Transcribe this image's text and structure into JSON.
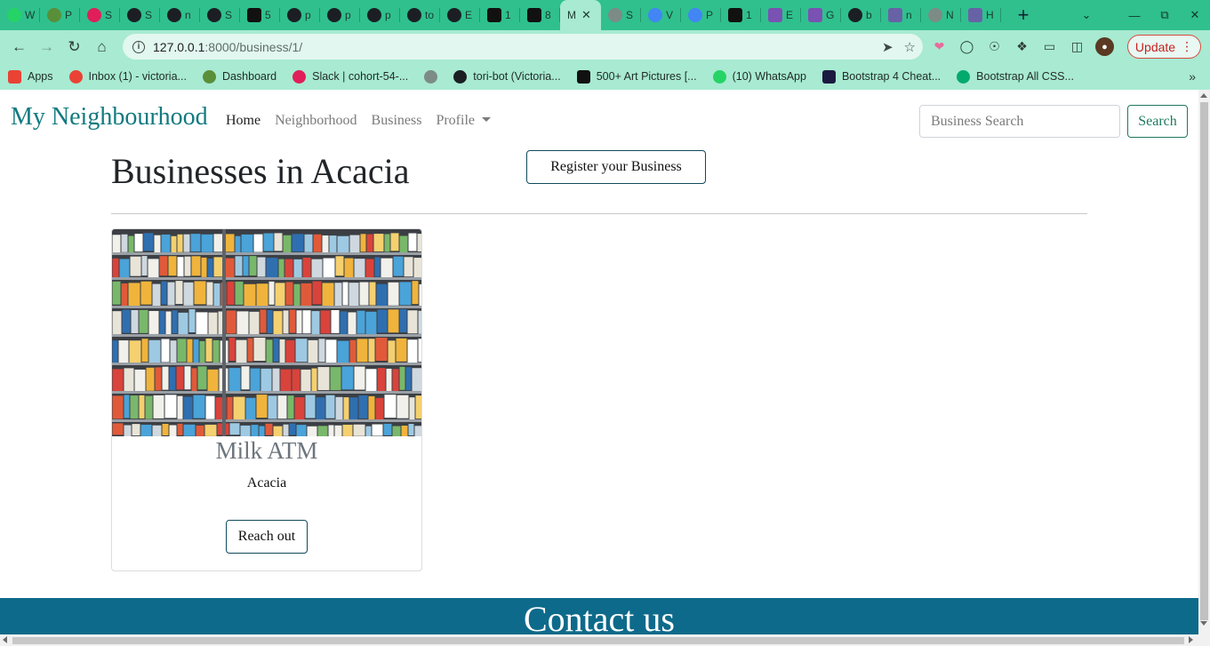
{
  "browser": {
    "tabs": [
      {
        "label": "W",
        "icon": "whatsapp-icon",
        "color": "#25d366"
      },
      {
        "label": "P",
        "icon": "palm-tree-icon",
        "color": "#5a8f3a"
      },
      {
        "label": "S",
        "icon": "slack-icon",
        "color": "#e01e5a"
      },
      {
        "label": "S",
        "icon": "github-icon",
        "color": "#1b1f23"
      },
      {
        "label": "n",
        "icon": "github-icon",
        "color": "#1b1f23"
      },
      {
        "label": "S",
        "icon": "github-icon",
        "color": "#1b1f23"
      },
      {
        "label": "5",
        "icon": "unsplash-icon",
        "color": "#111111"
      },
      {
        "label": "p",
        "icon": "github-icon",
        "color": "#1b1f23"
      },
      {
        "label": "p",
        "icon": "github-icon",
        "color": "#1b1f23"
      },
      {
        "label": "p",
        "icon": "github-icon",
        "color": "#1b1f23"
      },
      {
        "label": "to",
        "icon": "github-icon",
        "color": "#1b1f23"
      },
      {
        "label": "E",
        "icon": "github-icon",
        "color": "#1b1f23"
      },
      {
        "label": "1",
        "icon": "is-icon",
        "color": "#111111"
      },
      {
        "label": "8",
        "icon": "is-icon",
        "color": "#111111"
      },
      {
        "label": "M",
        "icon": "",
        "color": "",
        "active": true
      },
      {
        "label": "S",
        "icon": "globe-icon",
        "color": "#7d8b86"
      },
      {
        "label": "V",
        "icon": "google-icon",
        "color": "#4285f4"
      },
      {
        "label": "P",
        "icon": "google-icon",
        "color": "#4285f4"
      },
      {
        "label": "1",
        "icon": "unsplash-icon",
        "color": "#111111"
      },
      {
        "label": "E",
        "icon": "bootstrap-icon",
        "color": "#7952b3"
      },
      {
        "label": "G",
        "icon": "bootstrap-icon",
        "color": "#7952b3"
      },
      {
        "label": "b",
        "icon": "github-icon",
        "color": "#1b1f23"
      },
      {
        "label": "n",
        "icon": "heroku-icon",
        "color": "#6762a6"
      },
      {
        "label": "N",
        "icon": "globe-icon",
        "color": "#7d8b86"
      },
      {
        "label": "H",
        "icon": "heroku-icon",
        "color": "#6762a6"
      }
    ],
    "url_host": "127.0.0.1",
    "url_rest": ":8000/business/1/",
    "update_label": "Update",
    "bookmarks": [
      {
        "label": "Apps",
        "icon": "apps-grid-icon",
        "color": "#e84335"
      },
      {
        "label": "Inbox (1) - victoria...",
        "icon": "gmail-icon",
        "color": "#ea4335"
      },
      {
        "label": "Dashboard",
        "icon": "palm-tree-icon",
        "color": "#5a8f3a"
      },
      {
        "label": "Slack | cohort-54-...",
        "icon": "slack-icon",
        "color": "#e01e5a"
      },
      {
        "label": "",
        "icon": "globe-icon",
        "color": "#7d8b86"
      },
      {
        "label": "tori-bot (Victoria...",
        "icon": "github-icon",
        "color": "#1b1f23"
      },
      {
        "label": "500+ Art Pictures [...",
        "icon": "unsplash-icon",
        "color": "#111111"
      },
      {
        "label": "(10) WhatsApp",
        "icon": "whatsapp-icon",
        "color": "#25d366"
      },
      {
        "label": "Bootstrap 4 Cheat...",
        "icon": "bootstrap-cheat-icon",
        "color": "#1a1a40"
      },
      {
        "label": "Bootstrap All CSS...",
        "icon": "w3-icon",
        "color": "#04aa6d"
      }
    ]
  },
  "site": {
    "brand": "My Neighbourhood",
    "nav": [
      {
        "label": "Home",
        "active": true
      },
      {
        "label": "Neighborhood",
        "active": false
      },
      {
        "label": "Business",
        "active": false
      }
    ],
    "profile_label": "Profile",
    "search_placeholder": "Business Search",
    "search_button": "Search"
  },
  "main": {
    "heading": "Businesses in Acacia",
    "register_button": "Register your Business",
    "card": {
      "title": "Milk ATM",
      "location": "Acacia",
      "button": "Reach out"
    }
  },
  "footer": {
    "title": "Contact us"
  },
  "colors": {
    "tabstrip": "#2fc08e",
    "toolbar": "#a8ead2",
    "brand": "#117a80",
    "footer": "#0e6a8a",
    "search_border": "#1c7a5e"
  }
}
